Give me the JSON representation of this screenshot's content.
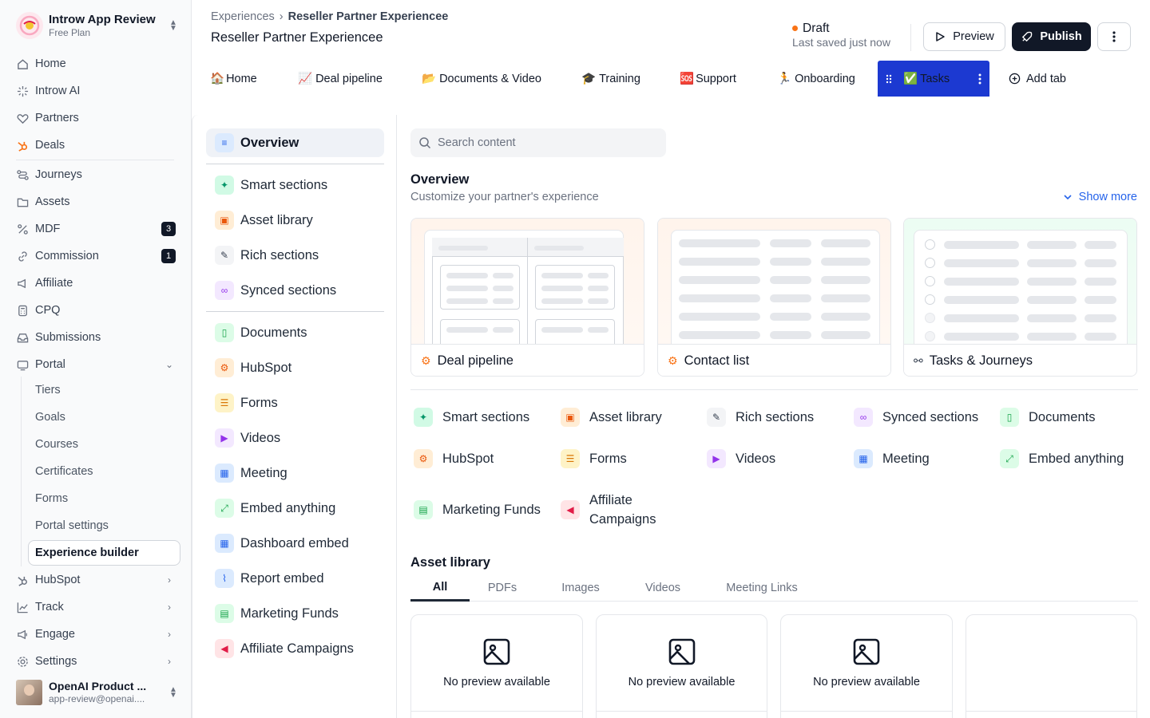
{
  "workspace": {
    "name": "Introw App Review",
    "plan": "Free Plan"
  },
  "sidebar": {
    "items": [
      {
        "label": "Home",
        "icon": "home-icon"
      },
      {
        "label": "Introw AI",
        "icon": "sparkle-icon"
      },
      {
        "label": "Partners",
        "icon": "handshake-icon"
      },
      {
        "label": "Deals",
        "icon": "hubspot-icon"
      },
      {
        "label": "Journeys",
        "icon": "route-icon"
      },
      {
        "label": "Assets",
        "icon": "folder-icon"
      },
      {
        "label": "MDF",
        "icon": "percent-icon",
        "badge": "3"
      },
      {
        "label": "Commission",
        "icon": "link-icon",
        "badge": "1"
      },
      {
        "label": "Affiliate",
        "icon": "megaphone-icon"
      },
      {
        "label": "CPQ",
        "icon": "calculator-icon"
      },
      {
        "label": "Submissions",
        "icon": "inbox-icon"
      },
      {
        "label": "Portal",
        "icon": "portal-icon"
      }
    ],
    "portal_sub": [
      "Tiers",
      "Goals",
      "Courses",
      "Certificates",
      "Forms",
      "Portal settings",
      "Experience builder"
    ],
    "bottom_items": [
      {
        "label": "HubSpot",
        "icon": "hubspot-icon"
      },
      {
        "label": "Track",
        "icon": "chart-icon"
      },
      {
        "label": "Engage",
        "icon": "engage-icon"
      },
      {
        "label": "Settings",
        "icon": "gear-icon"
      }
    ],
    "user": {
      "name": "OpenAI Product ...",
      "email": "app-review@openai...."
    }
  },
  "header": {
    "breadcrumb_root": "Experiences",
    "breadcrumb_current": "Reseller Partner Experiencee",
    "title": "Reseller Partner Experiencee",
    "status": "Draft",
    "saved": "Last saved just now",
    "preview_label": "Preview",
    "publish_label": "Publish"
  },
  "tabs": [
    {
      "emoji": "🏠",
      "label": "Home"
    },
    {
      "emoji": "📈",
      "label": "Deal pipeline"
    },
    {
      "emoji": "📂",
      "label": "Documents & Video"
    },
    {
      "emoji": "🎓",
      "label": "Training"
    },
    {
      "emoji": "🆘",
      "label": "Support"
    },
    {
      "emoji": "🏃",
      "label": "Onboarding"
    },
    {
      "emoji": "✅",
      "label": "Tasks"
    }
  ],
  "add_tab_label": "Add tab",
  "left_panel": {
    "overview": "Overview",
    "group1": [
      "Smart sections",
      "Asset library",
      "Rich sections",
      "Synced sections"
    ],
    "group2": [
      "Documents",
      "HubSpot",
      "Forms",
      "Videos",
      "Meeting",
      "Embed anything",
      "Dashboard embed",
      "Report embed",
      "Marketing Funds",
      "Affiliate Campaigns"
    ]
  },
  "search": {
    "placeholder": "Search content"
  },
  "overview": {
    "title": "Overview",
    "subtitle": "Customize your partner's experience",
    "show_more": "Show more",
    "cards": [
      "Deal pipeline",
      "Contact list",
      "Tasks & Journeys"
    ]
  },
  "section_grid": [
    "Smart sections",
    "Asset library",
    "Rich sections",
    "Synced sections",
    "Documents",
    "HubSpot",
    "Forms",
    "Videos",
    "Meeting",
    "Embed anything",
    "Marketing Funds",
    "Affiliate Campaigns"
  ],
  "asset_library": {
    "title": "Asset library",
    "tabs": [
      "All",
      "PDFs",
      "Images",
      "Videos",
      "Meeting Links"
    ],
    "empty_text": "No preview available"
  },
  "colors": {
    "accent": "#1c39d1",
    "publish": "#111827",
    "draft_dot": "#f97316",
    "link": "#2563eb"
  }
}
